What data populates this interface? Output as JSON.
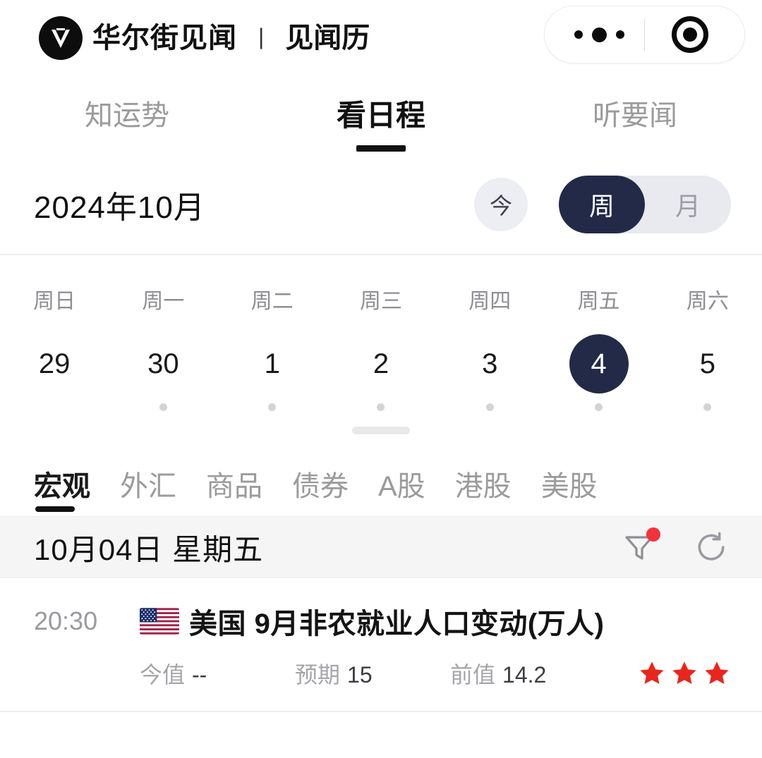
{
  "header": {
    "brand_name": "华尔街见闻",
    "separator": "|",
    "sub_title": "见闻历",
    "capsule": {
      "more_icon": "more-dots-icon",
      "target_icon": "target-icon"
    }
  },
  "top_tabs": [
    {
      "label": "知运势",
      "active": false
    },
    {
      "label": "看日程",
      "active": true
    },
    {
      "label": "听要闻",
      "active": false
    }
  ],
  "month_bar": {
    "month_label": "2024年10月",
    "today_button": "今",
    "view_toggle": {
      "options": [
        "周",
        "月"
      ],
      "selected": "周"
    }
  },
  "calendar": {
    "day_names": [
      "周日",
      "周一",
      "周二",
      "周三",
      "周四",
      "周五",
      "周六"
    ],
    "days": [
      {
        "num": "29",
        "selected": false,
        "has_dot": false
      },
      {
        "num": "30",
        "selected": false,
        "has_dot": true
      },
      {
        "num": "1",
        "selected": false,
        "has_dot": true
      },
      {
        "num": "2",
        "selected": false,
        "has_dot": true
      },
      {
        "num": "3",
        "selected": false,
        "has_dot": true
      },
      {
        "num": "4",
        "selected": true,
        "has_dot": true
      },
      {
        "num": "5",
        "selected": false,
        "has_dot": true
      }
    ]
  },
  "category_tabs": [
    {
      "label": "宏观",
      "active": true
    },
    {
      "label": "外汇",
      "active": false
    },
    {
      "label": "商品",
      "active": false
    },
    {
      "label": "债券",
      "active": false
    },
    {
      "label": "A股",
      "active": false
    },
    {
      "label": "港股",
      "active": false
    },
    {
      "label": "美股",
      "active": false
    }
  ],
  "date_bar": {
    "title": "10月04日 星期五",
    "filter_icon": "filter-funnel-icon",
    "filter_has_badge": true,
    "refresh_icon": "refresh-icon"
  },
  "events": [
    {
      "time": "20:30",
      "flag": "us-flag-icon",
      "title": "美国 9月非农就业人口变动(万人)",
      "metrics": [
        {
          "label": "今值",
          "value": "--"
        },
        {
          "label": "预期",
          "value": "15"
        },
        {
          "label": "前值",
          "value": "14.2"
        }
      ],
      "importance": 3
    }
  ],
  "colors": {
    "accent_dark": "#232a48",
    "star_red": "#e8261c",
    "badge_red": "#f5323c",
    "text_primary": "#111111",
    "text_muted": "#9b9b9b"
  }
}
